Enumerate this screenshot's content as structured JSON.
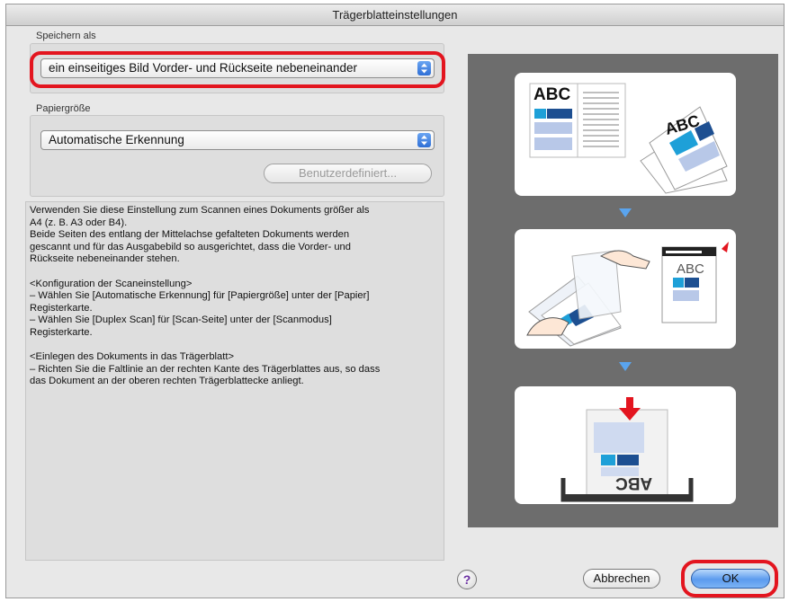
{
  "window": {
    "title": "Trägerblatteinstellungen"
  },
  "save_as": {
    "label": "Speichern als",
    "value": "ein einseitiges Bild Vorder- und Rückseite nebeneinander"
  },
  "paper_size": {
    "label": "Papiergröße",
    "value": "Automatische Erkennung",
    "custom_button": "Benutzerdefiniert..."
  },
  "description": [
    "Verwenden Sie diese Einstellung zum Scannen eines Dokuments größer als\nA4 (z. B. A3 oder B4).\nBeide Seiten des entlang der Mittelachse gefalteten Dokuments werden\ngescannt und für das Ausgabebild so ausgerichtet, dass die Vorder- und\nRückseite nebeneinander stehen.",
    "<Konfiguration der Scaneinstellung>\n– Wählen Sie [Automatische Erkennung] für [Papiergröße] unter der [Papier]\nRegisterkarte.\n– Wählen Sie [Duplex Scan] für [Scan-Seite] unter der [Scanmodus]\nRegisterkarte.",
    "<Einlegen des Dokuments in das Trägerblatt>\n– Richten Sie die Faltlinie an der rechten Kante des Trägerblattes aus, so dass\ndas Dokument an der oberen rechten Trägerblattecke anliegt."
  ],
  "illustration": {
    "abc_text": "ABC"
  },
  "buttons": {
    "help": "?",
    "cancel": "Abbrechen",
    "ok": "OK"
  },
  "colors": {
    "highlight": "#e3151f",
    "accent": "#3d7fe0",
    "doc_blue": "#1e88c8"
  }
}
